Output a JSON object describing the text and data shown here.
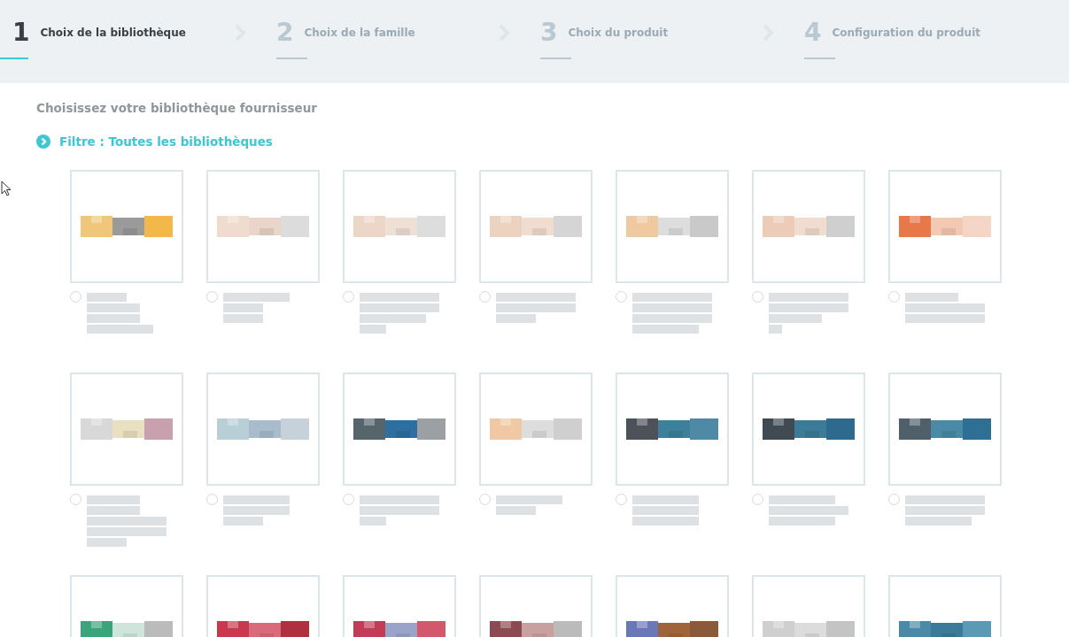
{
  "steps": [
    {
      "number": "1",
      "label": "Choix de la bibliothèque",
      "selected": true
    },
    {
      "number": "2",
      "label": "Choix de la famille",
      "selected": false
    },
    {
      "number": "3",
      "label": "Choix du produit",
      "selected": false
    },
    {
      "number": "4",
      "label": "Configuration du produit",
      "selected": false
    }
  ],
  "heading": "Choisissez votre bibliothèque fournisseur",
  "filter": {
    "label": "Filtre : Toutes les bibliothèques",
    "expanded": false
  },
  "libraries": [
    {
      "kind": "full",
      "selected": false
    },
    {
      "kind": "full",
      "selected": false
    },
    {
      "kind": "full",
      "selected": false
    },
    {
      "kind": "full",
      "selected": false
    },
    {
      "kind": "full",
      "selected": false
    },
    {
      "kind": "full",
      "selected": false
    },
    {
      "kind": "full",
      "selected": false
    },
    {
      "kind": "full",
      "selected": false
    },
    {
      "kind": "full",
      "selected": false
    },
    {
      "kind": "full",
      "selected": false
    },
    {
      "kind": "full",
      "selected": false
    },
    {
      "kind": "full",
      "selected": false
    },
    {
      "kind": "full",
      "selected": false
    },
    {
      "kind": "full",
      "selected": false
    },
    {
      "kind": "cut"
    },
    {
      "kind": "cut"
    },
    {
      "kind": "cut"
    },
    {
      "kind": "cut"
    },
    {
      "kind": "cut"
    },
    {
      "kind": "cut"
    },
    {
      "kind": "cut"
    }
  ]
}
